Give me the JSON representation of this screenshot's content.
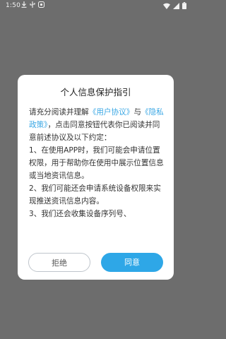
{
  "status_bar": {
    "time": "1:50",
    "icons": [
      "download-icon",
      "usb-icon",
      "notification-icon",
      "wifi-icon",
      "signal-icon",
      "battery-icon"
    ]
  },
  "dialog": {
    "title": "个人信息保护指引",
    "intro_prefix": "请充分阅读并理解",
    "user_agreement_link": "《用户协议》",
    "connector": "与",
    "privacy_policy_link": "《隐私政策》",
    "intro_suffix": "，点击同意按钮代表你已阅读并同意前述协议及以下约定：",
    "items": [
      "1、在使用APP时，我们可能会申请位置权限，用于帮助你在使用中展示位置信息或当地资讯信息。",
      "2、我们可能还会申请系统设备权限来实现推送资讯信息内容。",
      "3、我们还会收集设备序列号、"
    ],
    "reject_label": "拒绝",
    "agree_label": "同意"
  },
  "colors": {
    "overlay": "#6d6d6d",
    "link": "#3aa7e4",
    "agree_button": "#2ea7e7"
  }
}
